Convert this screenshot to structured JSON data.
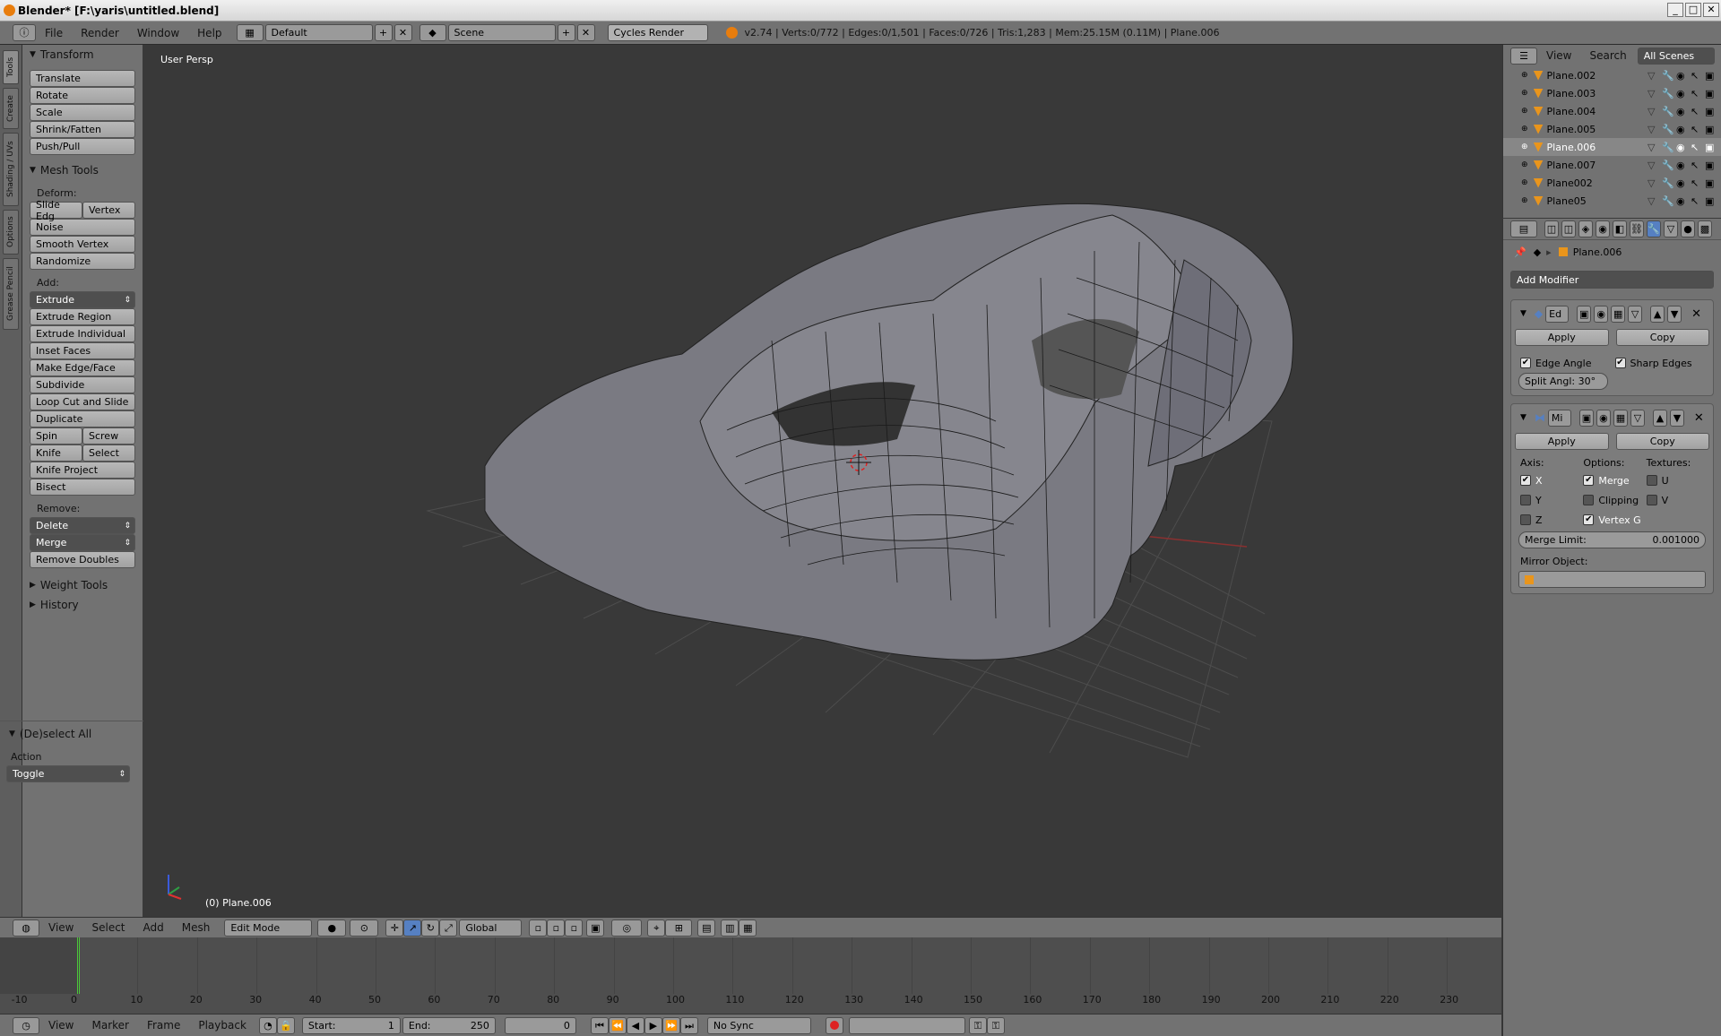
{
  "window": {
    "title": "Blender* [F:\\yaris\\untitled.blend]"
  },
  "infobar": {
    "menus": [
      "File",
      "Render",
      "Window",
      "Help"
    ],
    "layout": "Default",
    "scene": "Scene",
    "engine": "Cycles Render",
    "stats": "v2.74 | Verts:0/772 | Edges:0/1,501 | Faces:0/726 | Tris:1,283 | Mem:25.15M (0.11M) | Plane.006"
  },
  "tool_tabs": [
    "Tools",
    "Create",
    "Shading / UVs",
    "Options",
    "Grease Pencil"
  ],
  "toolshelf": {
    "transform_title": "Transform",
    "transform": [
      "Translate",
      "Rotate",
      "Scale",
      "Shrink/Fatten",
      "Push/Pull"
    ],
    "meshtools_title": "Mesh Tools",
    "deform_label": "Deform:",
    "slide_edge": "Slide Edg",
    "vertex": "Vertex",
    "deform": [
      "Noise",
      "Smooth Vertex",
      "Randomize"
    ],
    "add_label": "Add:",
    "extrude": "Extrude",
    "add": [
      "Extrude Region",
      "Extrude Individual",
      "Inset Faces",
      "Make Edge/Face",
      "Subdivide",
      "Loop Cut and Slide",
      "Duplicate"
    ],
    "spin": "Spin",
    "screw": "Screw",
    "knife": "Knife",
    "select": "Select",
    "add2": [
      "Knife Project",
      "Bisect"
    ],
    "remove_label": "Remove:",
    "delete": "Delete",
    "merge": "Merge",
    "remove_doubles": "Remove Doubles",
    "weight_tools": "Weight Tools",
    "history": "History",
    "operator_title": "(De)select All",
    "action_label": "Action",
    "action_value": "Toggle"
  },
  "viewport": {
    "persp": "User Persp",
    "object": "(0) Plane.006"
  },
  "view_header": {
    "menus": [
      "View",
      "Select",
      "Add",
      "Mesh"
    ],
    "mode": "Edit Mode",
    "orientation": "Global"
  },
  "timeline": {
    "ticks": [
      "-10",
      "0",
      "10",
      "20",
      "30",
      "40",
      "50",
      "60",
      "70",
      "80",
      "90",
      "100",
      "110",
      "120",
      "130",
      "140",
      "150",
      "160",
      "170",
      "180",
      "190",
      "200",
      "210",
      "220",
      "230"
    ],
    "menus": [
      "View",
      "Marker",
      "Frame",
      "Playback"
    ],
    "start_label": "Start:",
    "start": "1",
    "end_label": "End:",
    "end": "250",
    "current": "0",
    "sync": "No Sync"
  },
  "outliner": {
    "tabs": [
      "View",
      "Search",
      "All Scenes"
    ],
    "items": [
      "Plane.002",
      "Plane.003",
      "Plane.004",
      "Plane.005",
      "Plane.006",
      "Plane.007",
      "Plane002",
      "Plane05"
    ],
    "selected_index": 4
  },
  "properties": {
    "object": "Plane.006",
    "add_modifier": "Add Modifier",
    "mod1": {
      "name": "Ed",
      "apply": "Apply",
      "copy": "Copy",
      "edge_angle": "Edge Angle",
      "sharp_edges": "Sharp Edges",
      "split_angle": "Split Angl: 30°"
    },
    "mod2": {
      "name": "Mi",
      "apply": "Apply",
      "copy": "Copy",
      "axis_label": "Axis:",
      "options_label": "Options:",
      "textures_label": "Textures:",
      "x": "X",
      "y": "Y",
      "z": "Z",
      "merge": "Merge",
      "clipping": "Clipping",
      "vertex_g": "Vertex G",
      "u": "U",
      "v": "V",
      "merge_limit_label": "Merge Limit:",
      "merge_limit": "0.001000",
      "mirror_object": "Mirror Object:"
    }
  }
}
